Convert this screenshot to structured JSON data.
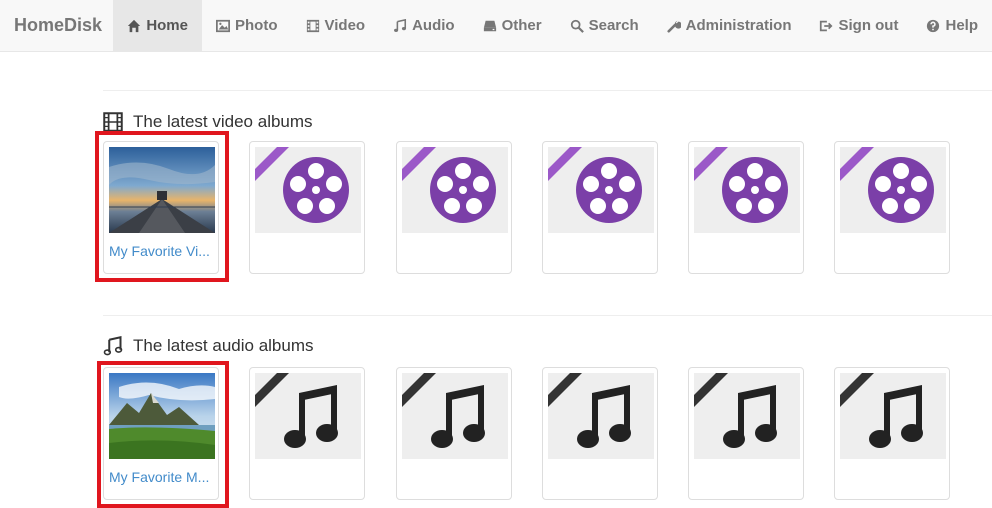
{
  "navbar": {
    "brand": "HomeDisk",
    "items": [
      {
        "label": "Home",
        "icon": "home-icon",
        "active": true
      },
      {
        "label": "Photo",
        "icon": "picture-icon"
      },
      {
        "label": "Video",
        "icon": "film-icon"
      },
      {
        "label": "Audio",
        "icon": "music-note-icon"
      },
      {
        "label": "Other",
        "icon": "hdd-icon"
      },
      {
        "label": "Search",
        "icon": "search-icon"
      },
      {
        "label": "Administration",
        "icon": "wrench-icon"
      },
      {
        "label": "Sign out",
        "icon": "sign-out-icon"
      },
      {
        "label": "Help",
        "icon": "question-icon"
      }
    ]
  },
  "video_section": {
    "title": "The latest video albums",
    "icon": "film-icon",
    "albums": [
      {
        "caption": "My Favorite Vi...",
        "image": "pier-sunset-photo",
        "highlighted": true
      },
      {
        "caption": "",
        "image": "video-reel-icon"
      },
      {
        "caption": "",
        "image": "video-reel-icon"
      },
      {
        "caption": "",
        "image": "video-reel-icon"
      },
      {
        "caption": "",
        "image": "video-reel-icon"
      },
      {
        "caption": "",
        "image": "video-reel-icon"
      }
    ]
  },
  "audio_section": {
    "title": "The latest audio albums",
    "icon": "music-note-icon",
    "albums": [
      {
        "caption": "My Favorite M...",
        "image": "mountain-lake-photo",
        "highlighted": true
      },
      {
        "caption": "",
        "image": "music-note-icon"
      },
      {
        "caption": "",
        "image": "music-note-icon"
      },
      {
        "caption": "",
        "image": "music-note-icon"
      },
      {
        "caption": "",
        "image": "music-note-icon"
      },
      {
        "caption": "",
        "image": "music-note-icon"
      }
    ]
  },
  "colors": {
    "link": "#428bca",
    "highlight": "#e0161e",
    "video_ribbon": "#9b59c8",
    "video_reel": "#7b3fa8",
    "audio_ribbon": "#333333"
  }
}
